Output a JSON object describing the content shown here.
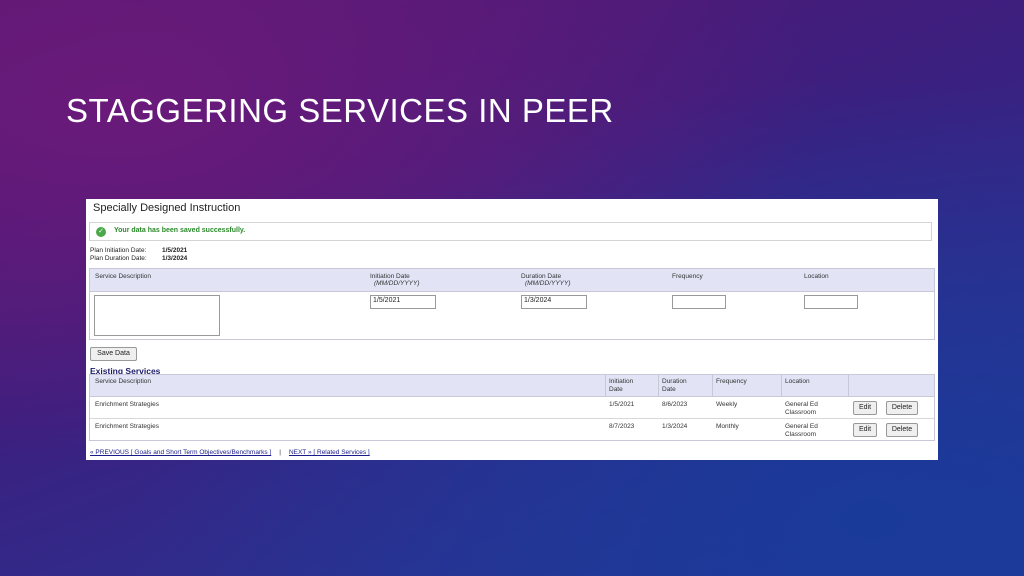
{
  "slide_title": "STAGGERING SERVICES IN PEER",
  "panel": {
    "title": "Specially Designed Instruction",
    "success_message": "Your data has been saved successfully.",
    "plan_initiation_label": "Plan Initiation Date:",
    "plan_initiation_value": "1/5/2021",
    "plan_duration_label": "Plan Duration Date:",
    "plan_duration_value": "1/3/2024"
  },
  "form": {
    "headers": {
      "service_description": "Service Description",
      "initiation_date": "Initiation Date",
      "initiation_date_format": "(MM/DD/YYYY)",
      "duration_date": "Duration Date",
      "duration_date_format": "(MM/DD/YYYY)",
      "frequency": "Frequency",
      "location": "Location"
    },
    "initiation_value": "1/5/2021",
    "duration_value": "1/3/2024",
    "frequency_value": "",
    "location_value": "",
    "save_label": "Save Data"
  },
  "existing": {
    "title": "Existing Services",
    "headers": {
      "service_description": "Service Description",
      "initiation_date": "Initiation Date",
      "duration_date": "Duration Date",
      "frequency": "Frequency",
      "location": "Location"
    },
    "rows": [
      {
        "description": "Enrichment Strategies",
        "initiation": "1/5/2021",
        "duration": "8/6/2023",
        "frequency": "Weekly",
        "location": "General Ed Classroom",
        "edit": "Edit",
        "delete": "Delete"
      },
      {
        "description": "Enrichment Strategies",
        "initiation": "8/7/2023",
        "duration": "1/3/2024",
        "frequency": "Monthly",
        "location": "General Ed Classroom",
        "edit": "Edit",
        "delete": "Delete"
      }
    ]
  },
  "nav": {
    "previous": "« PREVIOUS [ Goals and Short Term Objectives/Benchmarks ]",
    "separator": "|",
    "next": "NEXT » [ Related Services ]"
  },
  "colors": {
    "success_green": "#2a8a2a",
    "header_bg": "#e2e4f6",
    "link_blue": "#1a1a8a"
  }
}
